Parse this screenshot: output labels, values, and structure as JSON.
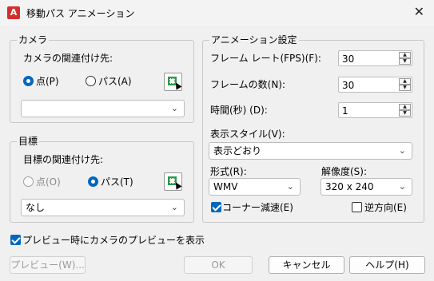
{
  "window": {
    "title": "移動パス アニメーション",
    "app_icon": "A",
    "close_glyph": "✕"
  },
  "camera": {
    "legend": "カメラ",
    "link_label": "カメラの関連付け先:",
    "radio_point": "点(P)",
    "radio_path": "パス(A)",
    "selected": "point",
    "combo_value": ""
  },
  "target": {
    "legend": "目標",
    "link_label": "目標の関連付け先:",
    "radio_point": "点(O)",
    "radio_path": "パス(T)",
    "selected": "path",
    "combo_value": "なし"
  },
  "animation": {
    "legend": "アニメーション設定",
    "frame_rate_label": "フレーム レート(FPS)(F):",
    "frame_rate": "30",
    "frame_count_label": "フレームの数(N):",
    "frame_count": "30",
    "duration_label": "時間(秒) (D):",
    "duration": "1",
    "visual_style_label": "表示スタイル(V):",
    "visual_style": "表示どおり",
    "format_label": "形式(R):",
    "format": "WMV",
    "resolution_label": "解像度(S):",
    "resolution": "320 x 240",
    "corner_decel_label": "コーナー減速(E)",
    "corner_decel": true,
    "reverse_label": "逆方向(E)",
    "reverse": false
  },
  "preview_camera_label": "プレビュー時にカメラのプレビューを表示",
  "preview_camera": true,
  "buttons": {
    "preview": "プレビュー(W)...",
    "ok": "OK",
    "cancel": "キャンセル",
    "help": "ヘルプ(H)"
  },
  "icons": {
    "chevron": "⌄",
    "spin_up": "▲",
    "spin_down": "▼"
  }
}
